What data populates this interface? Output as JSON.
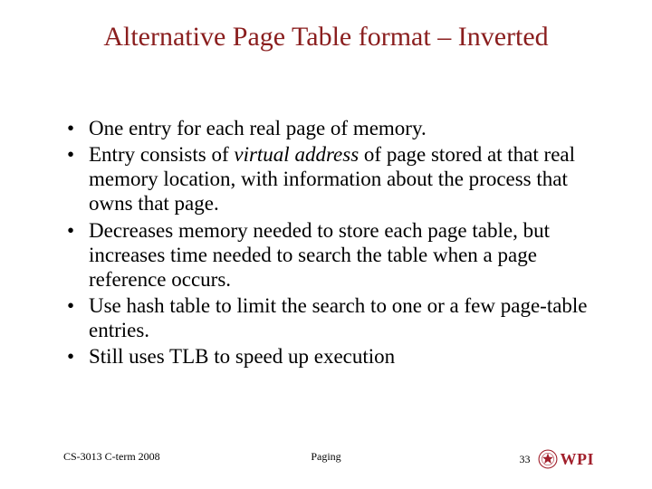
{
  "title": "Alternative Page Table format – Inverted",
  "bullets": {
    "b0": "One entry for each real page of memory.",
    "b1_pre": "Entry consists of ",
    "b1_it": "virtual address",
    "b1_post": " of page stored at that real memory location, with information about the process that owns that page.",
    "b2": "Decreases memory needed to store each page table, but increases time needed to search the table when a page reference occurs.",
    "b3": "Use hash table to limit the search to one or a few page-table entries.",
    "b4": "Still uses TLB to speed up execution"
  },
  "footer": {
    "left": "CS-3013 C-term 2008",
    "center": "Paging",
    "page": "33",
    "logo_text": "WPI"
  },
  "colors": {
    "title": "#8a1e1e",
    "logo": "#a11f2b"
  }
}
